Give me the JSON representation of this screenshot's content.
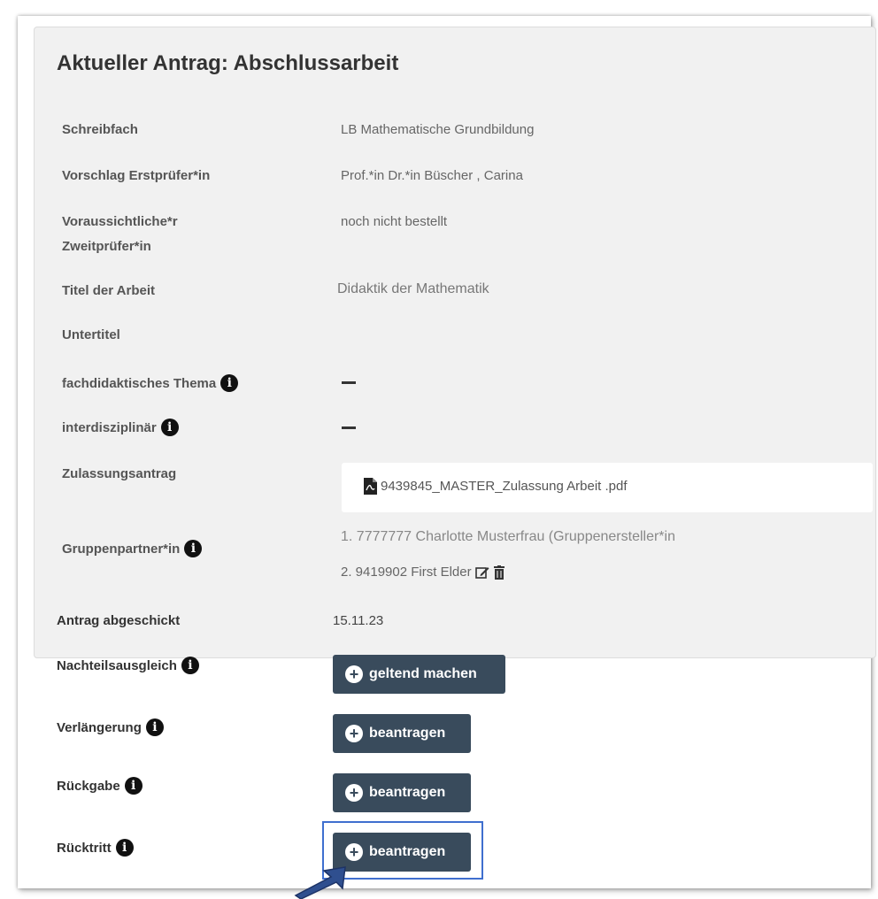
{
  "title": "Aktueller Antrag: Abschlussarbeit",
  "rows": [
    {
      "label": "Schreibfach",
      "value": "LB Mathematische Grundbildung"
    },
    {
      "label": "Vorschlag Erstprüfer*in",
      "value": "Prof.*in Dr.*in Büscher , Carina"
    },
    {
      "label_line1": "Voraussichtliche*r",
      "label_line2": "Zweitprüfer*in",
      "value": "noch nicht bestellt"
    },
    {
      "label": "Titel der Arbeit",
      "value": "Didaktik der Mathematik"
    },
    {
      "label": "Untertitel",
      "value": ""
    },
    {
      "label": "fachdidaktisches Thema",
      "value": "—"
    },
    {
      "label": "interdisziplinär",
      "value": "—"
    },
    {
      "label": "Zulassungsantrag",
      "file": "9439845_MASTER_Zulassung Arbeit .pdf"
    },
    {
      "label": "Gruppenpartner*in",
      "members": [
        "1. 7777777 Charlotte Musterfrau (Gruppenersteller*in",
        "2. 9419902 First Elder"
      ]
    }
  ],
  "submitted": {
    "label": "Antrag abgeschickt",
    "value": "15.11.23"
  },
  "actions": [
    {
      "label": "Nachteilsausgleich",
      "button": "geltend machen"
    },
    {
      "label": "Verlängerung",
      "button": "beantragen"
    },
    {
      "label": "Rückgabe",
      "button": "beantragen"
    },
    {
      "label": "Rücktritt",
      "button": "beantragen"
    }
  ],
  "icons": {
    "info": "info-circle-icon",
    "plus": "plus-circle-icon",
    "pdf": "pdf-file-icon",
    "edit": "edit-icon",
    "delete": "trash-icon",
    "pointer": "arrow-pointer-icon"
  },
  "colors": {
    "button_bg": "#394b5c",
    "highlight": "#3f6fcf",
    "panel_bg": "#f1f1f1"
  }
}
